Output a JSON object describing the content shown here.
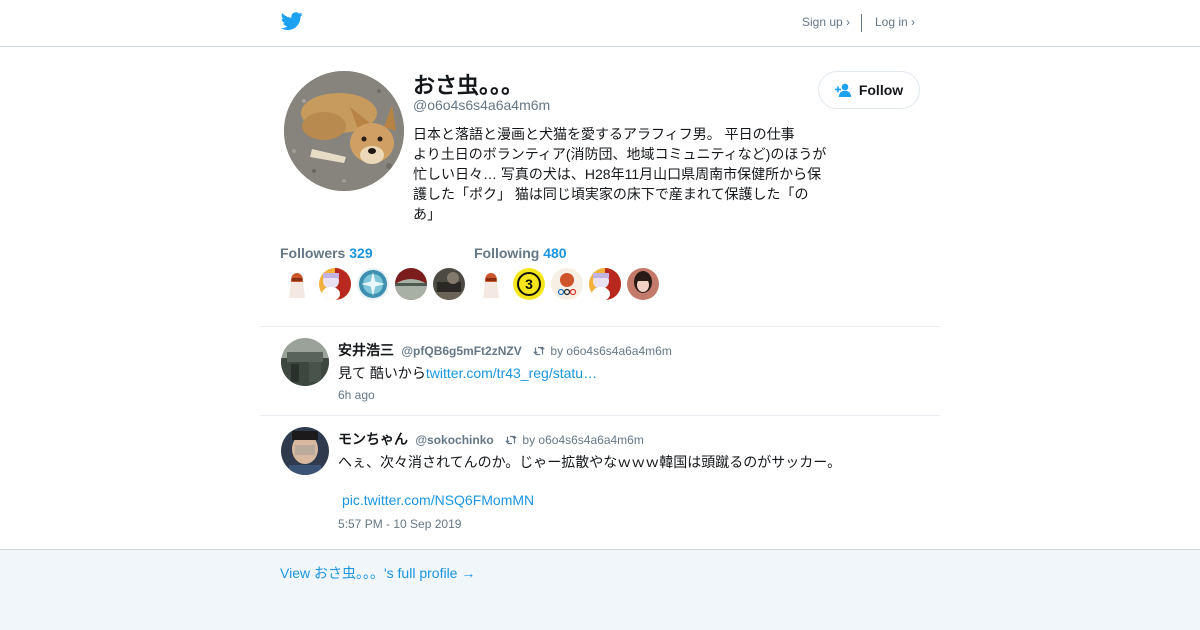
{
  "header": {
    "logo_icon": "twitter-bird-icon",
    "signup_label": "Sign up ›",
    "login_label": "Log in ›",
    "brand_color": "#1da1f2"
  },
  "profile": {
    "name": "おさ虫。。。",
    "handle": "@o6o4s6s4a6a4m6m",
    "bio": "日本と落語と漫画と犬猫を愛するアラフィフ男。 平日の仕事\nより土日のボランティア(消防団、地域コミュニティなど)のほうが\n忙しい日々… 写真の犬は、H28年11月山口県周南市保健所から保\n護した「ポク」 猫は同じ頃実家の床下で産まれて保護した「の\nあ」",
    "follow_label": "Follow"
  },
  "stats": {
    "followers_label": "Followers",
    "followers_count": "329",
    "following_label": "Following",
    "following_count": "480"
  },
  "tweets": [
    {
      "name": "安井浩三",
      "username": "@pfQB6g5mFt2zNZV",
      "retweet_by": "by o6o4s6s4a6a4m6m",
      "text": "見て 酷いから",
      "link": "twitter.com/tr43_reg/statu…",
      "time": "6h ago"
    },
    {
      "name": "モンちゃん",
      "username": "@sokochinko",
      "retweet_by": "by o6o4s6s4a6a4m6m",
      "text": "へぇ、次々消されてんのか。じゃー拡散やなｗｗｗ韓国は頭蹴るのがサッカー。",
      "link": "pic.twitter.com/NSQ6FMomMN",
      "time": "5:57 PM - 10 Sep 2019"
    }
  ],
  "footer": {
    "full_profile_label": "View おさ虫。。。's full profile →"
  },
  "colors": {
    "link": "#1b95e0",
    "secondary_text": "#657786",
    "footer_bg": "#f1f6fb"
  }
}
